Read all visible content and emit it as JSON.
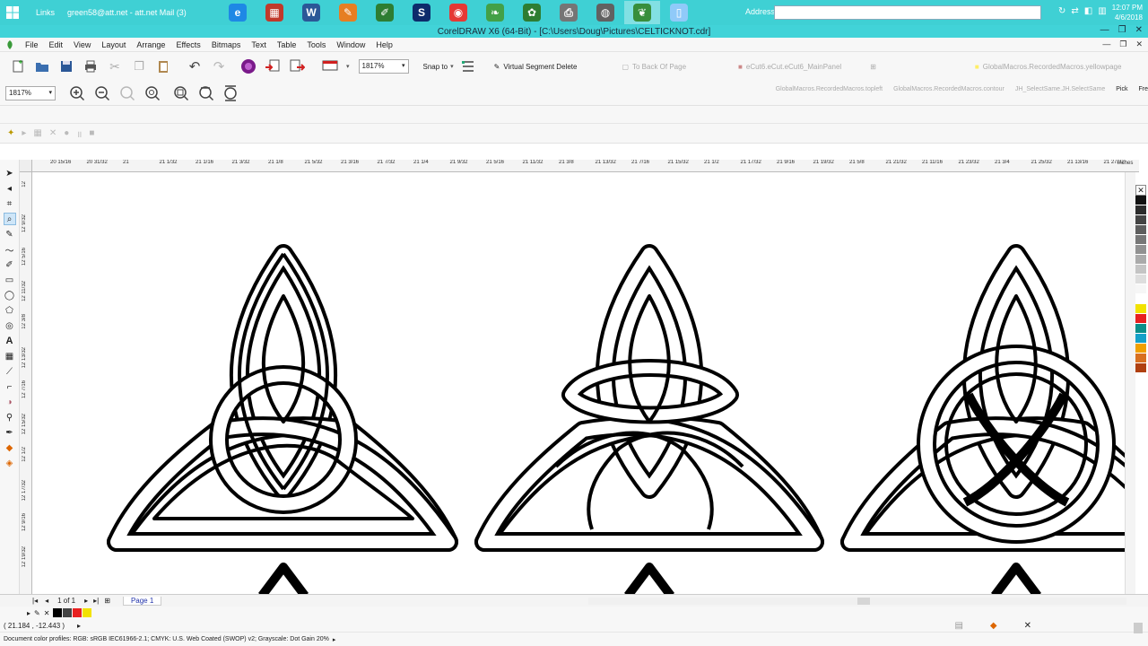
{
  "taskbar": {
    "links_label": "Links",
    "mail_label": "green58@att.net - att.net Mail (3)",
    "apps": [
      {
        "icon": "ie-icon",
        "glyph": "e",
        "color": "#1e88e5"
      },
      {
        "icon": "calculator-icon",
        "glyph": "▦",
        "color": "#c0392b"
      },
      {
        "icon": "word-icon",
        "glyph": "W",
        "color": "#2b5797"
      },
      {
        "icon": "paint-icon",
        "glyph": "✎",
        "color": "#e67e22"
      },
      {
        "icon": "pencil-icon",
        "glyph": "✐",
        "color": "#2e7d32"
      },
      {
        "icon": "s-app-icon",
        "glyph": "S",
        "color": "#0d2b6b"
      },
      {
        "icon": "chrome-icon",
        "glyph": "◉",
        "color": "#e53935"
      },
      {
        "icon": "leaf-app-icon",
        "glyph": "❧",
        "color": "#43a047"
      },
      {
        "icon": "corel-app-icon",
        "glyph": "✿",
        "color": "#2e7d32"
      },
      {
        "icon": "printer-icon",
        "glyph": "⎙",
        "color": "#757575"
      },
      {
        "icon": "network-icon",
        "glyph": "◍",
        "color": "#616161"
      },
      {
        "icon": "coreldraw-icon",
        "glyph": "❦",
        "color": "#388e3c"
      },
      {
        "icon": "document-icon",
        "glyph": "▯",
        "color": "#90caf9"
      }
    ],
    "address_label": "Address",
    "address_value": "",
    "clock_time": "12:07 PM",
    "clock_date": "4/6/2018"
  },
  "window": {
    "title": "CorelDRAW X6 (64-Bit) - [C:\\Users\\Doug\\Pictures\\CELTICKNOT.cdr]"
  },
  "menu": [
    "File",
    "Edit",
    "View",
    "Layout",
    "Arrange",
    "Effects",
    "Bitmaps",
    "Text",
    "Table",
    "Tools",
    "Window",
    "Help"
  ],
  "toolbar": {
    "zoom_value": "1817%",
    "snap_label": "Snap to",
    "virtual_segment_delete": "Virtual Segment Delete",
    "to_back_of_page": "To Back Of Page",
    "ecut_macro": "eCut6.eCut.eCut6_MainPanel",
    "yellowpage_macro": "GlobalMacros.RecordedMacros.yellowpage"
  },
  "propbar": {
    "zoom_value": "1817%",
    "macros": [
      "GlobalMacros.RecordedMacros.topleft",
      "GlobalMacros.RecordedMacros.contour",
      "JH_SelectSame.JH.SelectSame",
      "Pick",
      "Fre"
    ]
  },
  "rulers": {
    "horizontal": [
      "20 15/16",
      "20 31/32",
      "21",
      "21 1/32",
      "21 1/16",
      "21 3/32",
      "21 1/8",
      "21 5/32",
      "21 3/16",
      "21 7/32",
      "21 1/4",
      "21 9/32",
      "21 5/16",
      "21 11/32",
      "21 3/8",
      "21 13/32",
      "21 7/16",
      "21 15/32",
      "21 1/2",
      "21 17/32",
      "21 9/16",
      "21 19/32",
      "21 5/8",
      "21 21/32",
      "21 11/16",
      "21 23/32",
      "21 3/4",
      "21 25/32",
      "21 13/16",
      "21 27/32"
    ],
    "units": "inches",
    "vertical": [
      "12",
      "12 9/32",
      "12 5/16",
      "12 11/32",
      "12 3/8",
      "12 13/32",
      "12 7/16",
      "12 15/32",
      "12 1/2",
      "12 17/32",
      "12 9/16",
      "12 19/32"
    ]
  },
  "palette": [
    "#111111",
    "#2b2b2b",
    "#444444",
    "#5e5e5e",
    "#777777",
    "#919191",
    "#aaaaaa",
    "#c4c4c4",
    "#dddddd",
    "#f6f6f6",
    "#ffffff",
    "#f2e200",
    "#e82020",
    "#0a8f8a",
    "#14a0c8",
    "#f0a000",
    "#d87020",
    "#b04010"
  ],
  "pagebar": {
    "page_count": "1 of 1",
    "page_tab": "Page 1"
  },
  "doc_palette": [
    "#000000",
    "#444444",
    "#e82020",
    "#f2e200"
  ],
  "status": {
    "coordinates": "( 21.184 , -12.443 )",
    "color_profiles": "Document color profiles: RGB: sRGB IEC61966-2.1; CMYK: U.S. Web Coated (SWOP) v2; Grayscale: Dot Gain 20%"
  }
}
